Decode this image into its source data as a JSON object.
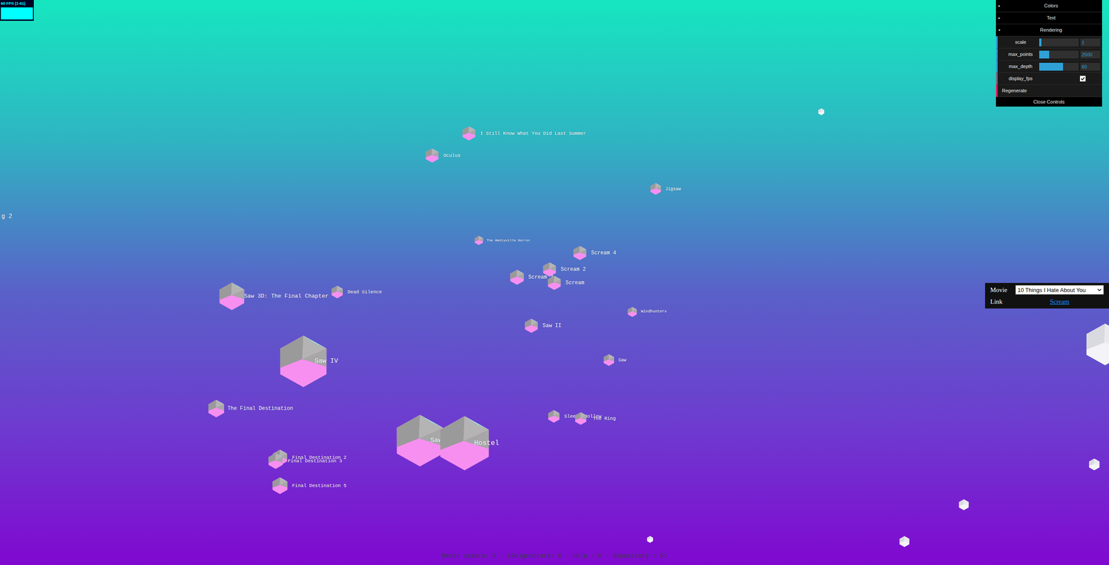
{
  "fps": {
    "reading": "60 FPS (1-61)"
  },
  "controls": {
    "folders": [
      {
        "label": "Colors",
        "icon": "▸",
        "expanded": false
      },
      {
        "label": "Text",
        "icon": "▸",
        "expanded": false
      },
      {
        "label": "Rendering",
        "icon": "▾",
        "expanded": true
      }
    ],
    "rendering_items": [
      {
        "kind": "slider",
        "label": "scale",
        "value": "1",
        "level": 0.05
      },
      {
        "kind": "slider",
        "label": "max_points",
        "value": "2500",
        "level": 0.25
      },
      {
        "kind": "slider",
        "label": "max_depth",
        "value": "60",
        "level": 0.6
      },
      {
        "kind": "checkbox",
        "label": "display_fps",
        "checked": true
      },
      {
        "kind": "button",
        "label": "Regenerate"
      }
    ],
    "close": "Close Controls"
  },
  "movie_panel": {
    "movie_label": "Movie",
    "movie_value": "10 Things I Hate About You",
    "link_label": "Link",
    "link_text": "Scream"
  },
  "help": "Reset camera: R - (Re)generate: G - Help : H - Repository : F1",
  "nodes": [
    {
      "label": "I Still Know What You Did Last Summer"
    },
    {
      "label": "Oculus"
    },
    {
      "label": "Jigsaw"
    },
    {
      "label": "The Amityville Horror"
    },
    {
      "label": "Scream 4"
    },
    {
      "label": "Scream 2"
    },
    {
      "label": "Scream 3"
    },
    {
      "label": "Scream"
    },
    {
      "label": "Dead Silence"
    },
    {
      "label": "Saw 3D: The Final Chapter"
    },
    {
      "label": "Windhunters"
    },
    {
      "label": "Saw II"
    },
    {
      "label": "Saw IV"
    },
    {
      "label": "Saw"
    },
    {
      "label": "The Final Destination"
    },
    {
      "label": "Sleepy Hollow"
    },
    {
      "label": "The Ring"
    },
    {
      "label": "Saw III"
    },
    {
      "label": "Hostel"
    },
    {
      "label": "Final Destination 2"
    },
    {
      "label": "Final Destination 3"
    },
    {
      "label": "Final Destination 5"
    },
    {
      "label": "g 2"
    },
    {
      "label": ""
    },
    {
      "label": ""
    },
    {
      "label": ""
    },
    {
      "label": ""
    },
    {
      "label": ""
    },
    {
      "label": ""
    }
  ]
}
